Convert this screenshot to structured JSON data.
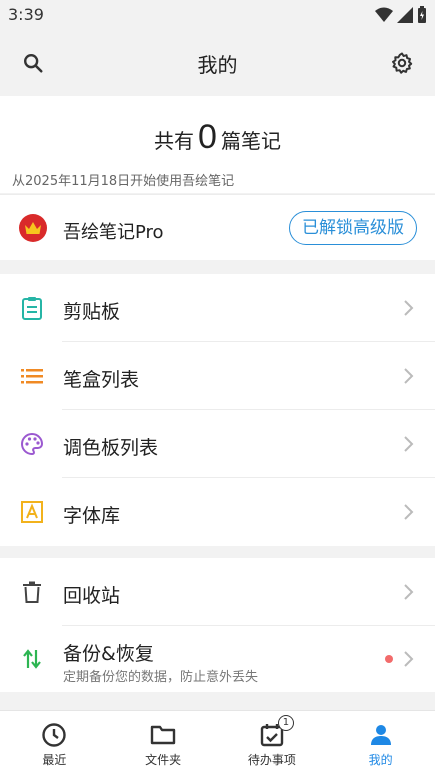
{
  "status_bar": {
    "time": "3:39"
  },
  "header": {
    "title": "我的"
  },
  "summary": {
    "prefix": "共有",
    "count": "0",
    "suffix": "篇笔记",
    "since": "从2025年11月18日开始使用吾绘笔记"
  },
  "pro": {
    "label": "吾绘笔记Pro",
    "badge": "已解锁高级版"
  },
  "menu_group1": [
    {
      "label": "剪贴板",
      "icon": "clipboard-icon",
      "color": "#26b5a6"
    },
    {
      "label": "笔盒列表",
      "icon": "list-icon",
      "color": "#f08a24"
    },
    {
      "label": "调色板列表",
      "icon": "palette-icon",
      "color": "#9b59d0"
    },
    {
      "label": "字体库",
      "icon": "font-icon",
      "color": "#f2b21c"
    }
  ],
  "menu_group2": {
    "recycle": {
      "label": "回收站",
      "icon": "trash-icon"
    },
    "backup": {
      "label": "备份&恢复",
      "sub": "定期备份您的数据，防止意外丢失",
      "icon": "sync-arrows-icon"
    }
  },
  "bottom_nav": [
    {
      "label": "最近",
      "icon": "clock-icon"
    },
    {
      "label": "文件夹",
      "icon": "folder-icon"
    },
    {
      "label": "待办事项",
      "icon": "calendar-check-icon",
      "badge": "1"
    },
    {
      "label": "我的",
      "icon": "person-icon",
      "active": true
    }
  ],
  "colors": {
    "accent": "#1e88e5",
    "pro_red": "#d92a2a",
    "badge_blue": "#2a8fd8"
  }
}
